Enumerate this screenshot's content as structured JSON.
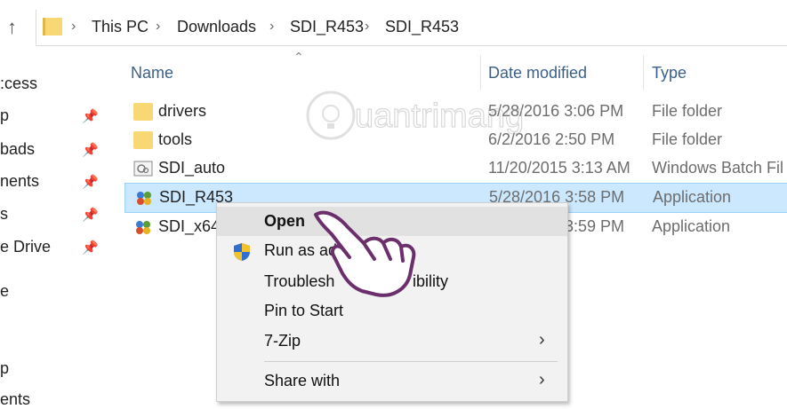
{
  "address_bar": {
    "breadcrumbs": [
      "This PC",
      "Downloads",
      "SDI_R453",
      "SDI_R453"
    ]
  },
  "sidebar": {
    "items": [
      {
        "label": ":cess",
        "pinned": false
      },
      {
        "label": "p",
        "pinned": true
      },
      {
        "label": "bads",
        "pinned": true
      },
      {
        "label": "nents",
        "pinned": true
      },
      {
        "label": "s",
        "pinned": true
      },
      {
        "label": "e Drive",
        "pinned": true
      },
      {
        "label": "e",
        "pinned": false
      },
      {
        "label": "p",
        "pinned": false
      },
      {
        "label": "ents",
        "pinned": false
      }
    ]
  },
  "columns": {
    "name": "Name",
    "date": "Date modified",
    "type": "Type"
  },
  "files": [
    {
      "name": "drivers",
      "date": "5/28/2016 3:06 PM",
      "type": "File folder",
      "icon": "folder-icon"
    },
    {
      "name": "tools",
      "date": "6/2/2016 2:50 PM",
      "type": "File folder",
      "icon": "folder-icon"
    },
    {
      "name": "SDI_auto",
      "date": "11/20/2015 3:13 AM",
      "type": "Windows Batch Fil",
      "icon": "batch-file-icon"
    },
    {
      "name": "SDI_R453",
      "date": "5/28/2016 3:58 PM",
      "type": "Application",
      "icon": "app-icon"
    },
    {
      "name": "SDI_x64_",
      "date": "3:59 PM",
      "type": "Application",
      "icon": "app-icon"
    }
  ],
  "context_menu": {
    "open": "Open",
    "run_as_admin": "Run as ad",
    "troubleshoot": "Troublesh",
    "troubleshoot_tail": "ibility",
    "pin_to_start": "Pin to Start",
    "seven_zip": "7-Zip",
    "share_with": "Share with"
  },
  "watermark": {
    "text": "uantrimang"
  },
  "colors": {
    "selection": "#cce8ff",
    "folder": "#f8d775",
    "hand": "#6b2f6b"
  }
}
